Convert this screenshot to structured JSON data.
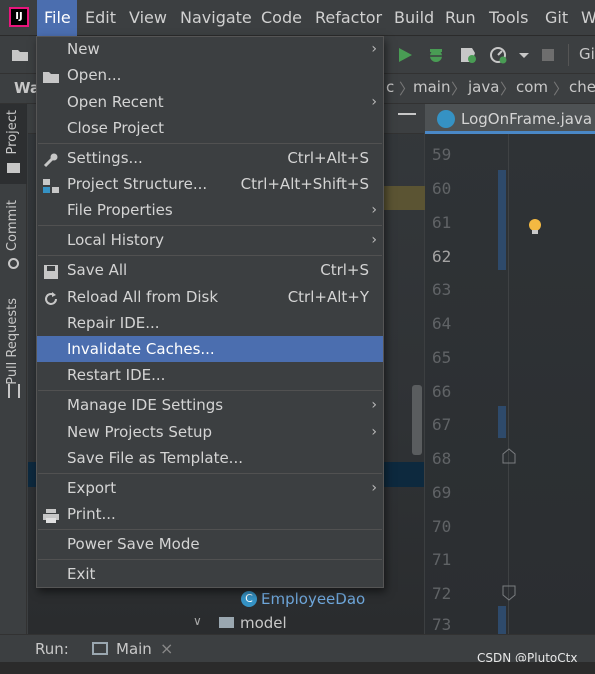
{
  "menubar": {
    "items": [
      {
        "label": "File",
        "active": true
      },
      {
        "label": "Edit"
      },
      {
        "label": "View"
      },
      {
        "label": "Navigate"
      },
      {
        "label": "Code"
      },
      {
        "label": "Refactor"
      },
      {
        "label": "Build"
      },
      {
        "label": "Run"
      },
      {
        "label": "Tools"
      },
      {
        "label": "Git"
      },
      {
        "label": "W"
      }
    ]
  },
  "toolbar": {
    "git_label": "Gi"
  },
  "navbar": {
    "crumbs": [
      "c",
      "main",
      "java",
      "com",
      "che"
    ],
    "left_stub": "Wa"
  },
  "tool_stripe": {
    "project": "Project",
    "commit": "Commit",
    "pull_requests": "Pull Requests"
  },
  "editor": {
    "tab_label": "LogOnFrame.java",
    "line_numbers": [
      "59",
      "60",
      "61",
      "62",
      "63",
      "64",
      "65",
      "66",
      "67",
      "68",
      "69",
      "70",
      "71",
      "72",
      "73"
    ],
    "current_line": "62"
  },
  "project_tree": {
    "employee_dao": "EmployeeDao",
    "model": "model"
  },
  "run_bar": {
    "label": "Run:",
    "tab": "Main",
    "close": "×",
    "watermark": "CSDN @PlutoCtx"
  },
  "file_menu": {
    "items": [
      {
        "label": "New",
        "submenu": true
      },
      {
        "label": "Open...",
        "icon": "folder-icon"
      },
      {
        "label": "Open Recent",
        "submenu": true
      },
      {
        "label": "Close Project"
      },
      {
        "label": "Settings...",
        "shortcut": "Ctrl+Alt+S",
        "icon": "wrench-icon"
      },
      {
        "label": "Project Structure...",
        "shortcut": "Ctrl+Alt+Shift+S",
        "icon": "project-structure-icon"
      },
      {
        "label": "File Properties",
        "submenu": true
      },
      {
        "label": "Local History",
        "submenu": true
      },
      {
        "label": "Save All",
        "shortcut": "Ctrl+S",
        "icon": "save-icon"
      },
      {
        "label": "Reload All from Disk",
        "shortcut": "Ctrl+Alt+Y",
        "icon": "reload-icon"
      },
      {
        "label": "Repair IDE..."
      },
      {
        "label": "Invalidate Caches...",
        "selected": true
      },
      {
        "label": "Restart IDE..."
      },
      {
        "label": "Manage IDE Settings",
        "submenu": true
      },
      {
        "label": "New Projects Setup",
        "submenu": true
      },
      {
        "label": "Save File as Template..."
      },
      {
        "label": "Export",
        "submenu": true
      },
      {
        "label": "Print...",
        "icon": "print-icon"
      },
      {
        "label": "Power Save Mode"
      },
      {
        "label": "Exit"
      }
    ],
    "arrow": "›"
  },
  "colors": {
    "selection": "#4b6eaf",
    "menu_bg": "#3c3f41",
    "accent_green": "#499c54"
  }
}
